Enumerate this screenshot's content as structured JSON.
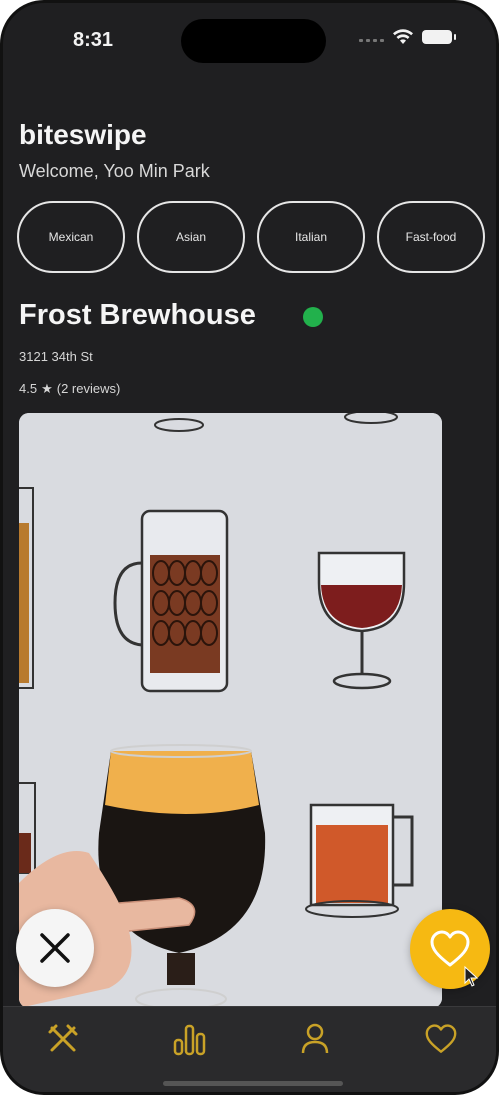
{
  "status_bar": {
    "time": "8:31"
  },
  "header": {
    "app_title": "biteswipe",
    "welcome": "Welcome, Yoo Min Park"
  },
  "categories": [
    "Mexican",
    "Asian",
    "Italian",
    "Fast-food"
  ],
  "restaurant": {
    "name": "Frost Brewhouse",
    "status_color": "#22b14c",
    "address": "3121 34th St",
    "rating_value": "4.5",
    "rating_star": "★",
    "reviews": "(2 reviews)"
  },
  "photo": {
    "icon": "beer-glasses-illustration"
  },
  "actions": {
    "dislike_icon": "close-icon",
    "like_icon": "heart-icon"
  },
  "tabs": [
    {
      "id": "restaurants",
      "icon": "utensils-icon"
    },
    {
      "id": "stats",
      "icon": "bar-chart-icon"
    },
    {
      "id": "profile",
      "icon": "user-icon"
    },
    {
      "id": "favorites",
      "icon": "heart-icon"
    }
  ],
  "colors": {
    "accent": "#f6b912",
    "tab_icon": "#c9a227",
    "background": "#1f1f21"
  }
}
